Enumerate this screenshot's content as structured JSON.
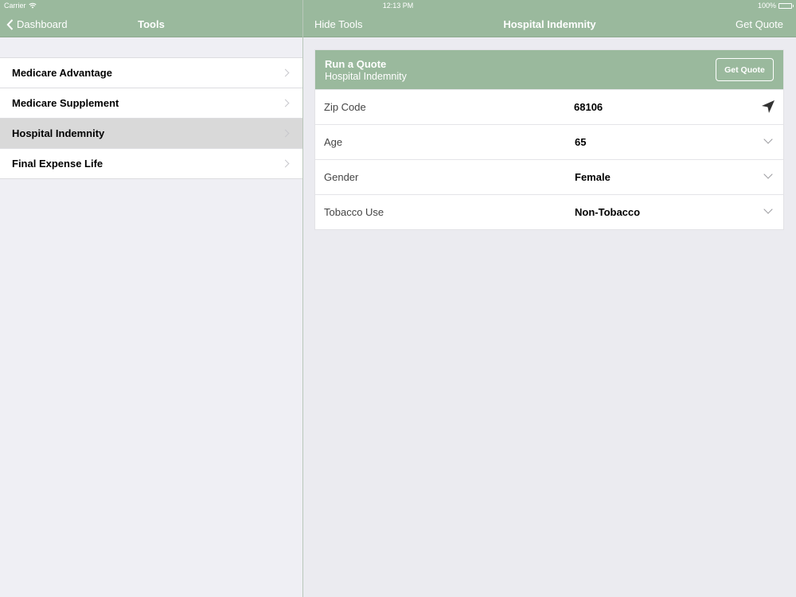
{
  "status": {
    "carrier": "Carrier",
    "time": "12:13 PM",
    "battery": "100%"
  },
  "nav": {
    "back_label": "Dashboard",
    "left_title": "Tools",
    "hide_label": "Hide Tools",
    "right_title": "Hospital Indemnity",
    "get_quote_label": "Get Quote"
  },
  "tools": {
    "items": [
      {
        "label": "Medicare Advantage"
      },
      {
        "label": "Medicare Supplement"
      },
      {
        "label": "Hospital Indemnity"
      },
      {
        "label": "Final Expense Life"
      }
    ],
    "selected_index": 2
  },
  "quote": {
    "title": "Run a Quote",
    "subtitle": "Hospital Indemnity",
    "button_label": "Get Quote",
    "fields": [
      {
        "label": "Zip Code",
        "value": "68106",
        "icon": "location-arrow-icon"
      },
      {
        "label": "Age",
        "value": "65",
        "icon": "chevron-down-icon"
      },
      {
        "label": "Gender",
        "value": "Female",
        "icon": "chevron-down-icon"
      },
      {
        "label": "Tobacco Use",
        "value": "Non-Tobacco",
        "icon": "chevron-down-icon"
      }
    ]
  },
  "colors": {
    "accent": "#9ab99d",
    "selected_row": "#d9d9d9"
  }
}
